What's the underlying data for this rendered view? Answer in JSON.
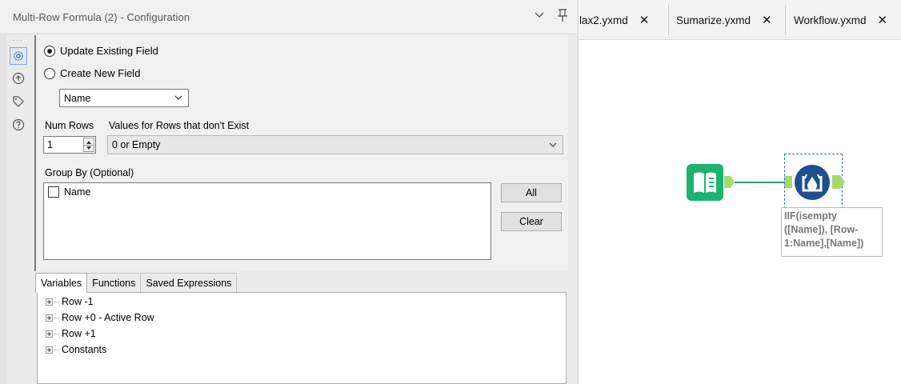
{
  "config": {
    "title": "Multi-Row Formula (2) - Configuration",
    "update_label": "Update Existing Field",
    "create_label": "Create New  Field",
    "field_select": "Name",
    "num_rows_label": "Num Rows",
    "num_rows_value": "1",
    "values_label": "Values for Rows that don't Exist",
    "values_select": "0 or Empty",
    "group_by_label": "Group By (Optional)",
    "group_items": [
      "Name"
    ],
    "all_button": "All",
    "clear_button": "Clear"
  },
  "expr_tabs": [
    "Variables",
    "Functions",
    "Saved Expressions"
  ],
  "tree": [
    "Row -1",
    "Row +0 - Active Row",
    "Row +1",
    "Constants"
  ],
  "doc_tabs": [
    {
      "label": "lax2.yxmd",
      "close": "✕"
    },
    {
      "label": "Sumarize.yxmd",
      "close": "✕"
    },
    {
      "label": "Workflow.yxmd",
      "close": "✕"
    }
  ],
  "annotation": "IIF(isempty\n([Name]), [Row-\n1:Name],[Name])",
  "colors": {
    "input_tool": "#1bb36f",
    "multirow_tool": "#1f4f8f",
    "connector": "#2b9f5c",
    "anchor": "#a7d96c"
  }
}
